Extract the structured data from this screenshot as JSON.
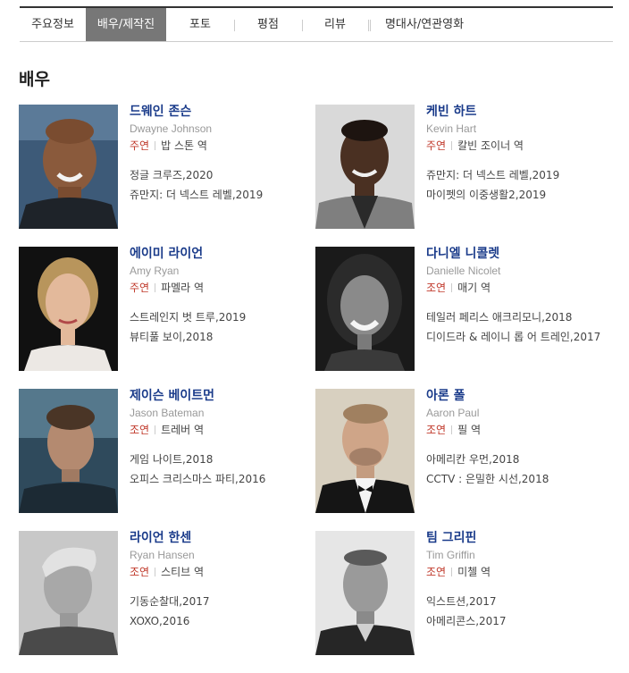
{
  "tabs": [
    {
      "label": "주요정보"
    },
    {
      "label": "배우/제작진",
      "active": true
    },
    {
      "label": "포토"
    },
    {
      "label": "평점"
    },
    {
      "label": "리뷰"
    },
    {
      "label": "명대사/연관영화"
    }
  ],
  "section_title": "배우",
  "actors": [
    {
      "name": "드웨인 존슨",
      "name_en": "Dwayne Johnson",
      "role_type": "주연",
      "role": "밥 스톤 역",
      "films": [
        "정글 크루즈,2020",
        "쥬만지: 더 넥스트 레벨,2019"
      ]
    },
    {
      "name": "케빈 하트",
      "name_en": "Kevin Hart",
      "role_type": "주연",
      "role": "칼빈 조이너 역",
      "films": [
        "쥬만지: 더 넥스트 레벨,2019",
        "마이펫의 이중생활2,2019"
      ]
    },
    {
      "name": "에이미 라이언",
      "name_en": "Amy Ryan",
      "role_type": "주연",
      "role": "파멜라 역",
      "films": [
        "스트레인지 벗 트루,2019",
        "뷰티풀 보이,2018"
      ]
    },
    {
      "name": "다니엘 니콜렛",
      "name_en": "Danielle Nicolet",
      "role_type": "조연",
      "role": "매기 역",
      "films": [
        "테일러 페리스 애크리모니,2018",
        "디이드라 & 레이니 롭 어 트레인,2017"
      ]
    },
    {
      "name": "제이슨 베이트먼",
      "name_en": "Jason Bateman",
      "role_type": "조연",
      "role": "트레버 역",
      "films": [
        "게임 나이트,2018",
        "오피스 크리스마스 파티,2016"
      ]
    },
    {
      "name": "아론 폴",
      "name_en": "Aaron Paul",
      "role_type": "조연",
      "role": "필 역",
      "films": [
        "아메리칸 우먼,2018",
        "CCTV : 은밀한 시선,2018"
      ]
    },
    {
      "name": "라이언 한센",
      "name_en": "Ryan Hansen",
      "role_type": "조연",
      "role": "스티브 역",
      "films": [
        "기동순찰대,2017",
        "XOXO,2016"
      ]
    },
    {
      "name": "팀 그리핀",
      "name_en": "Tim Griffin",
      "role_type": "조연",
      "role": "미첼 역",
      "films": [
        "익스트션,2017",
        "아메리콘스,2017"
      ]
    }
  ],
  "colors": {
    "name": "#1a3b8a",
    "role_type": "#c0392b",
    "tab_active_bg": "#777777"
  }
}
